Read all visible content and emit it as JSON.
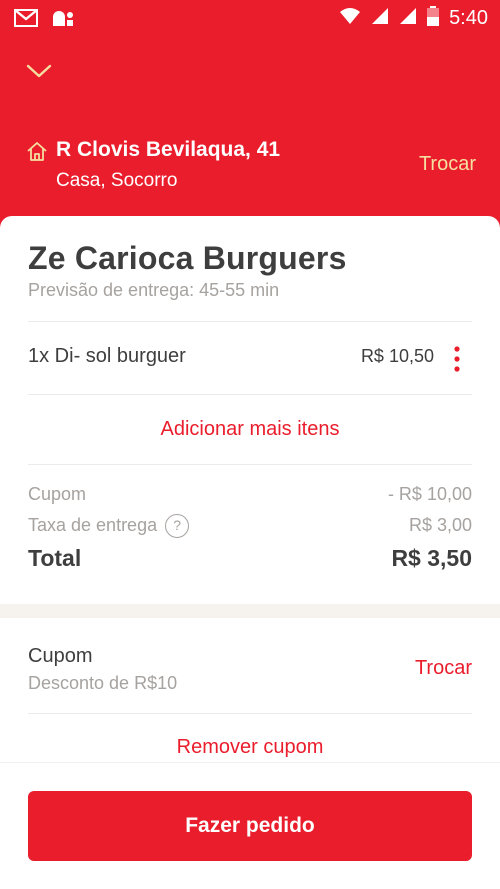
{
  "status_bar": {
    "time": "5:40",
    "left_icons": [
      "gmail-icon",
      "notification-app-icon"
    ],
    "right_icons": [
      "wifi-icon",
      "signal-icon",
      "signal-icon",
      "battery-icon"
    ]
  },
  "colors": {
    "brand_red": "#ea1d2c",
    "trocar_top": "#f5dea0",
    "text_dark": "#3e3e3e",
    "text_muted": "#a6a29f",
    "band": "#f6f2ee"
  },
  "header": {
    "collapse_icon": "chevron-down-icon",
    "address_line": "R Clovis Bevilaqua, 41",
    "address_sub": "Casa, Socorro",
    "change_label": "Trocar"
  },
  "restaurant": {
    "name": "Ze Carioca Burguers",
    "eta": "Previsão de entrega: 45-55 min"
  },
  "items": [
    {
      "qty_name": "1x  Di- sol burguer",
      "price": "R$ 10,50"
    }
  ],
  "add_more": "Adicionar mais itens",
  "summary": {
    "coupon_label": "Cupom",
    "coupon_value": "- R$ 10,00",
    "delivery_label": "Taxa de entrega",
    "delivery_help": "?",
    "delivery_value": "R$ 3,00",
    "total_label": "Total",
    "total_value": "R$ 3,50"
  },
  "coupon_section": {
    "title": "Cupom",
    "description": "Desconto de R$10",
    "change_label": "Trocar",
    "remove_label": "Remover cupom"
  },
  "footer": {
    "order_button": "Fazer pedido"
  }
}
